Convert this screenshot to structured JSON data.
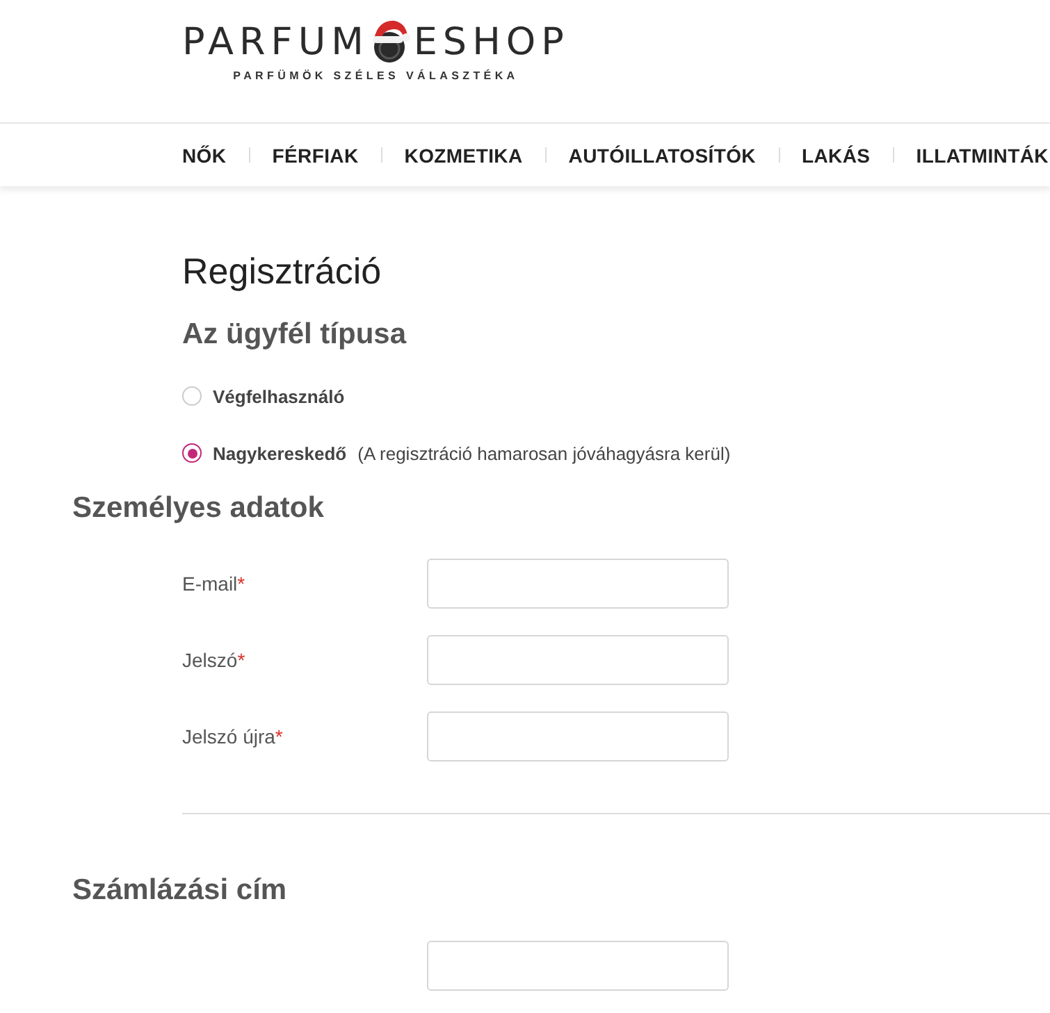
{
  "logo": {
    "left": "PARFUM",
    "right": "ESHOP",
    "tagline": "PARFÜMÖK SZÉLES VÁLASZTÉKA"
  },
  "nav": [
    "NŐK",
    "FÉRFIAK",
    "KOZMETIKA",
    "AUTÓILLATOSÍTÓK",
    "LAKÁS",
    "ILLATMINTÁK"
  ],
  "page_title": "Regisztráció",
  "customer_type": {
    "title": "Az ügyfél típusa",
    "options": [
      {
        "label": "Végfelhasználó",
        "selected": false
      },
      {
        "label": "Nagykereskedő",
        "note": "(A regisztráció hamarosan jóváhagyásra kerül)",
        "selected": true
      }
    ]
  },
  "personal": {
    "title": "Személyes adatok",
    "fields": [
      {
        "label": "E-mail",
        "required_mark": "*",
        "disabled": false
      },
      {
        "label": "Jelszó",
        "required_mark": "*",
        "disabled": false
      },
      {
        "label": "Jelszó újra",
        "required_mark": "*",
        "disabled": false
      }
    ]
  },
  "billing": {
    "title": "Számlázási cím",
    "fields": [
      {
        "disabled": false
      }
    ]
  }
}
